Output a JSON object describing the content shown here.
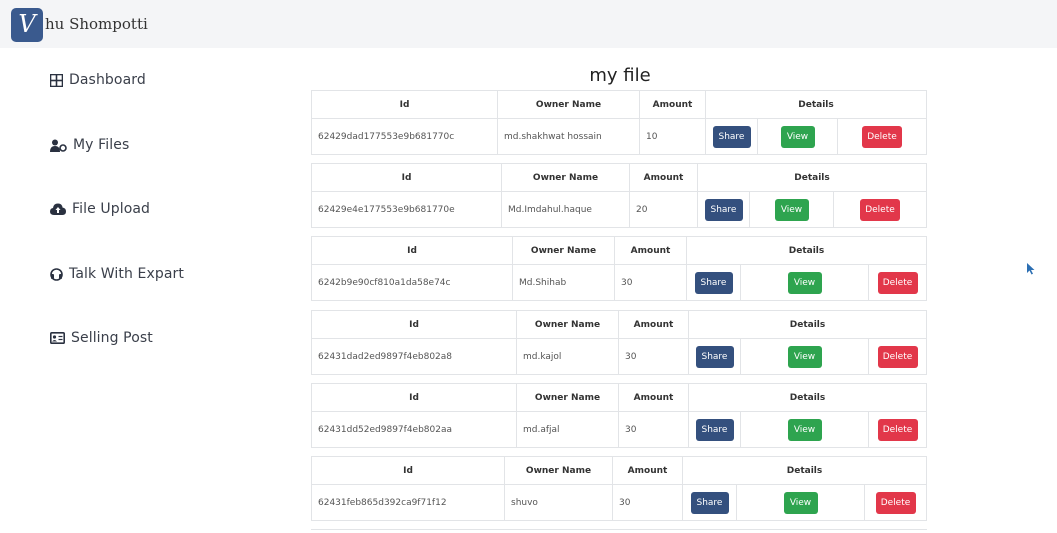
{
  "app": {
    "logo_letter": "V",
    "brand_name": "hu Shompotti"
  },
  "sidebar": {
    "items": [
      {
        "label": "Dashboard",
        "icon": "grid-icon"
      },
      {
        "label": "My Files",
        "icon": "users-icon"
      },
      {
        "label": "File Upload",
        "icon": "cloud-upload-icon"
      },
      {
        "label": "Talk With Expart",
        "icon": "headset-icon"
      },
      {
        "label": "Selling Post",
        "icon": "id-card-icon"
      }
    ]
  },
  "main": {
    "title": "my file",
    "headers": {
      "id": "Id",
      "owner": "Owner Name",
      "amount": "Amount",
      "details": "Details"
    },
    "buttons": {
      "share": "Share",
      "view": "View",
      "delete": "Delete"
    },
    "rows": [
      {
        "id": "62429dad177553e9b681770c",
        "owner": "md.shakhwat hossain",
        "amount": "10"
      },
      {
        "id": "62429e4e177553e9b681770e",
        "owner": "Md.Imdahul.haque",
        "amount": "20"
      },
      {
        "id": "6242b9e90cf810a1da58e74c",
        "owner": "Md.Shihab",
        "amount": "30"
      },
      {
        "id": "62431dad2ed9897f4eb802a8",
        "owner": "md.kajol",
        "amount": "30"
      },
      {
        "id": "62431dd52ed9897f4eb802aa",
        "owner": "md.afjal",
        "amount": "30"
      },
      {
        "id": "62431feb865d392ca9f71f12",
        "owner": "shuvo",
        "amount": "30"
      }
    ]
  },
  "colors": {
    "share": "#34507e",
    "view": "#2ea44f",
    "delete": "#e2374a",
    "logo": "#3a5a8e"
  }
}
